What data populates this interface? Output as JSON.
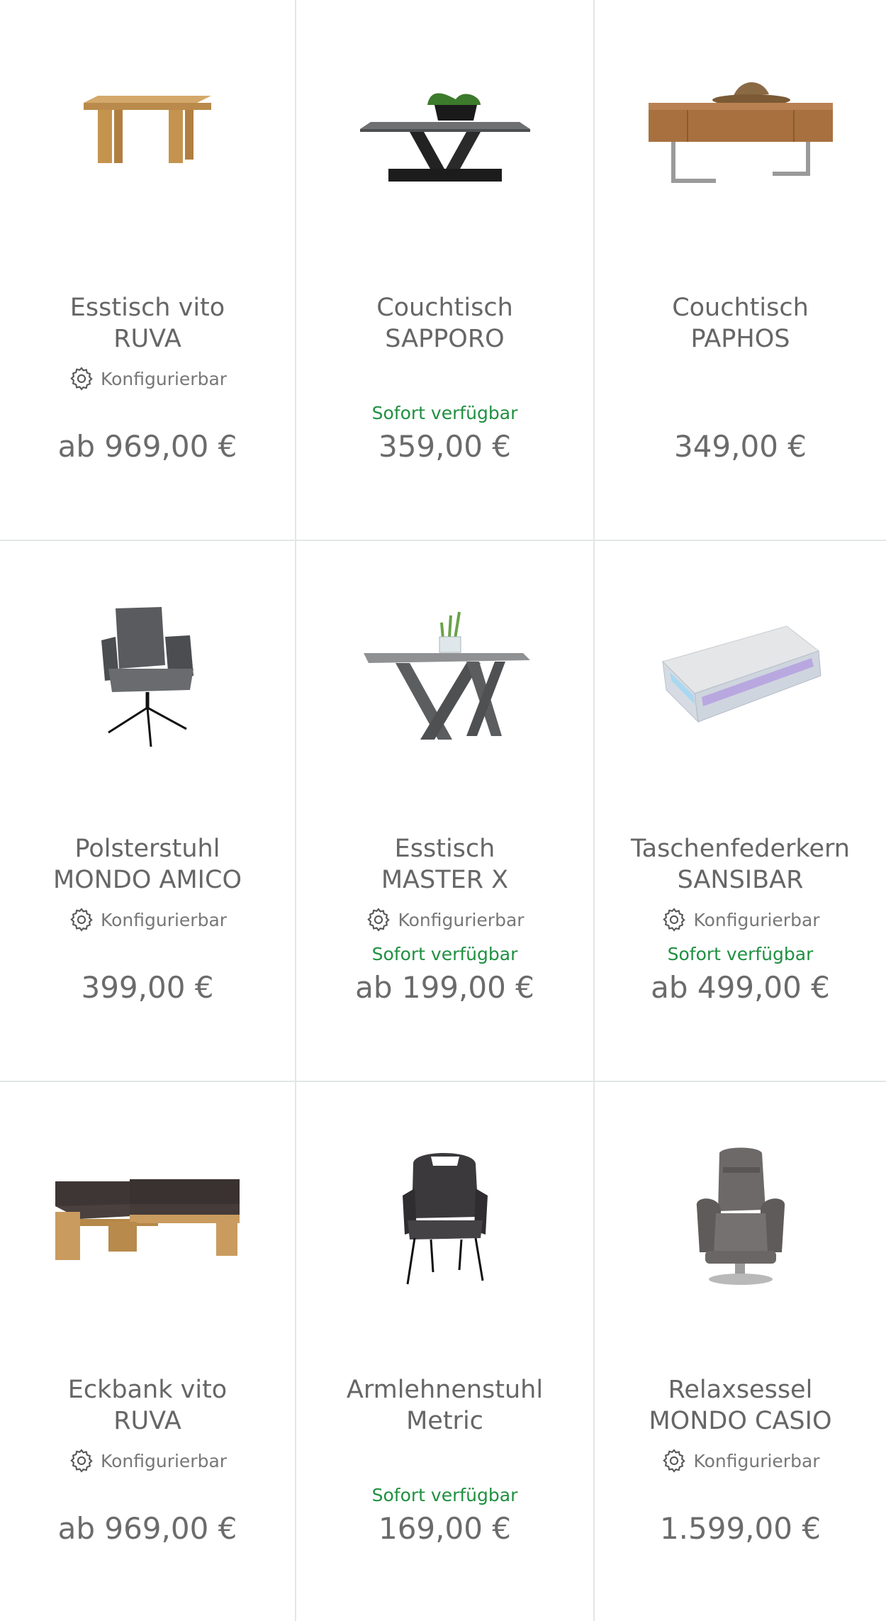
{
  "products": [
    {
      "title_line1": "Esstisch vito",
      "title_line2": "RUVA",
      "configurable": true,
      "config_label": "Konfigurierbar",
      "availability": "",
      "price": "ab 969,00 €",
      "image_icon": "wooden-dining-table"
    },
    {
      "title_line1": "Couchtisch",
      "title_line2": "SAPPORO",
      "configurable": false,
      "config_label": "",
      "availability": "Sofort verfügbar",
      "price": "359,00 €",
      "image_icon": "coffee-table-v-base"
    },
    {
      "title_line1": "Couchtisch",
      "title_line2": "PAPHOS",
      "configurable": false,
      "config_label": "",
      "availability": "",
      "price": "349,00 €",
      "image_icon": "wood-coffee-table-metal-legs"
    },
    {
      "title_line1": "Polsterstuhl",
      "title_line2": "MONDO AMICO",
      "configurable": true,
      "config_label": "Konfigurierbar",
      "availability": "",
      "price": "399,00 €",
      "image_icon": "upholstered-chair"
    },
    {
      "title_line1": "Esstisch",
      "title_line2": "MASTER X",
      "configurable": true,
      "config_label": "Konfigurierbar",
      "availability": "Sofort verfügbar",
      "price": "ab 199,00 €",
      "image_icon": "x-leg-dining-table"
    },
    {
      "title_line1": "Taschenfederkern",
      "title_line2": "SANSIBAR",
      "configurable": true,
      "config_label": "Konfigurierbar",
      "availability": "Sofort verfügbar",
      "price": "ab 499,00 €",
      "image_icon": "mattress"
    },
    {
      "title_line1": "Eckbank vito",
      "title_line2": "RUVA",
      "configurable": true,
      "config_label": "Konfigurierbar",
      "availability": "",
      "price": "ab 969,00 €",
      "image_icon": "corner-bench"
    },
    {
      "title_line1": "Armlehnenstuhl",
      "title_line2": "Metric",
      "configurable": false,
      "config_label": "",
      "availability": "Sofort verfügbar",
      "price": "169,00 €",
      "image_icon": "armchair-metal-legs"
    },
    {
      "title_line1": "Relaxsessel",
      "title_line2": "MONDO CASIO",
      "configurable": true,
      "config_label": "Konfigurierbar",
      "availability": "",
      "price": "1.599,00 €",
      "image_icon": "recliner-chair"
    }
  ],
  "colors": {
    "availability_green": "#1f9040",
    "text_gray": "#666666",
    "divider": "#e3e6e6"
  }
}
